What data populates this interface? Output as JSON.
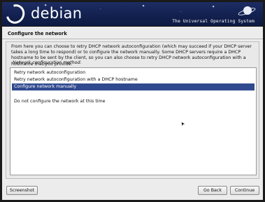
{
  "banner": {
    "logo_text": "debian",
    "tagline": "The Universal Operating System"
  },
  "page": {
    "title": "Configure the network",
    "description": "From here you can choose to retry DHCP network autoconfiguration (which may succeed if your DHCP server takes a long time to respond) or to configure the network manually. Some DHCP servers require a DHCP hostname to be sent by the client, so you can also choose to retry DHCP network autoconfiguration with a hostname that you provide.",
    "method_label": "Network configuration method:"
  },
  "options": [
    {
      "label": "Retry network autoconfiguration",
      "selected": false
    },
    {
      "label": "Retry network autoconfiguration with a DHCP hostname",
      "selected": false
    },
    {
      "label": "Configure network manually",
      "selected": true
    },
    {
      "label": "",
      "selected": false
    },
    {
      "label": "Do not configure the network at this time",
      "selected": false
    }
  ],
  "buttons": {
    "screenshot": "Screenshot",
    "go_back": "Go Back",
    "continue": "Continue"
  },
  "colors": {
    "selection": "#304a8f",
    "banner": "#12204e"
  }
}
